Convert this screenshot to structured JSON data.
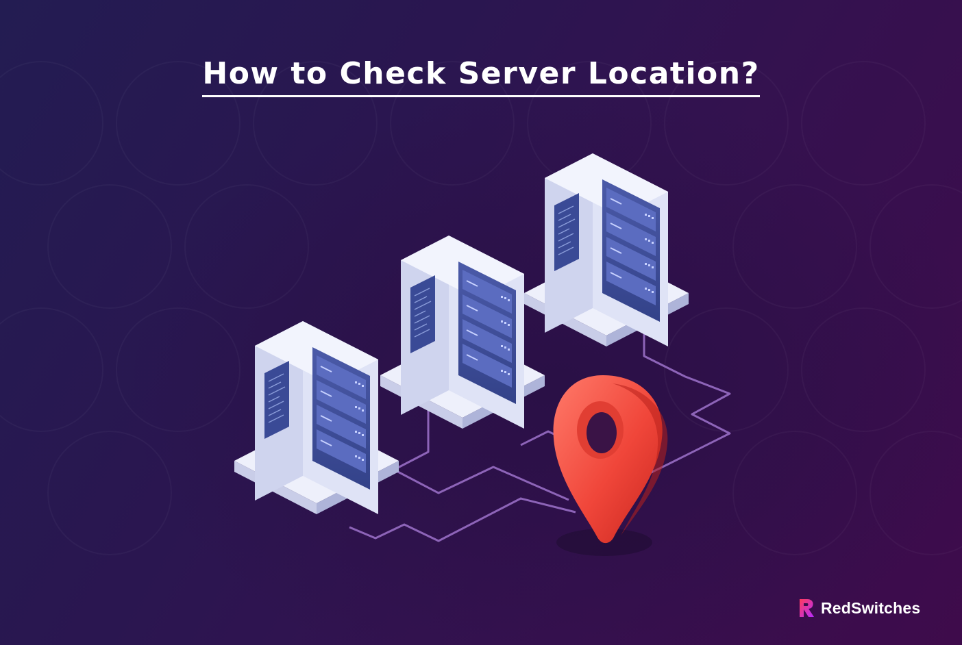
{
  "banner": {
    "title": "How to Check Server Location?",
    "brand_name": "RedSwitches"
  },
  "illustration": {
    "server_count": 3,
    "icons": [
      "server-rack-icon",
      "map-pin-icon"
    ],
    "colors": {
      "pin": "#f0463a",
      "server_body": "#dfe3f6",
      "server_panel": "#3f4f9b",
      "circuit_line": "#8d64b8"
    }
  },
  "colors": {
    "background_start": "#231c52",
    "background_end": "#3e0b4b",
    "title": "#ffffff",
    "brand_accent": "#ff3b5c"
  }
}
